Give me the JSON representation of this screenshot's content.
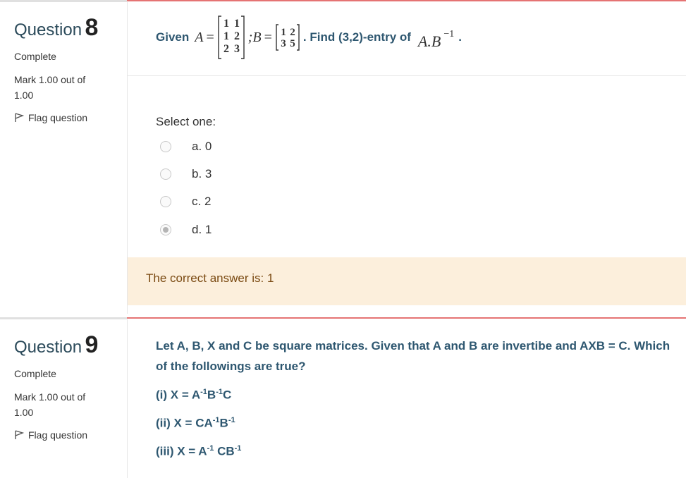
{
  "q8": {
    "label": "Question",
    "number": "8",
    "state": "Complete",
    "grade": "Mark 1.00 out of 1.00",
    "flag": "Flag question",
    "text_given": "Given",
    "math_A": "A",
    "math_eq": "=",
    "matrix_A": [
      [
        "1",
        "1"
      ],
      [
        "1",
        "2"
      ],
      [
        "2",
        "3"
      ]
    ],
    "math_sep": ";B",
    "matrix_B": [
      [
        "1",
        "2"
      ],
      [
        "3",
        "5"
      ]
    ],
    "text_find": ". Find (3,2)-entry of",
    "math_expr": "A.B",
    "math_exp": "−1",
    "math_end": ".",
    "prompt": "Select one:",
    "options": [
      {
        "label": "a. 0",
        "checked": false
      },
      {
        "label": "b. 3",
        "checked": false
      },
      {
        "label": "c. 2",
        "checked": false
      },
      {
        "label": "d. 1",
        "checked": true
      }
    ],
    "feedback": "The correct answer is: 1"
  },
  "q9": {
    "label": "Question",
    "number": "9",
    "state": "Complete",
    "grade": "Mark 1.00 out of 1.00",
    "flag": "Flag question",
    "text": "Let A, B, X and C be square matrices. Given that A and B are invertibe and AXB = C. Which of the followings are true?",
    "stmt1": {
      "a": "(i) X = A",
      "b": "-1",
      "c": "B",
      "d": "-1",
      "e": "C"
    },
    "stmt2": {
      "a": "(ii) X = CA",
      "b": "-1",
      "c": "B",
      "d": "-1"
    },
    "stmt3": {
      "a": "(iii) X = A",
      "b": "-1",
      "c": " CB",
      "d": "-1"
    }
  },
  "colors": {
    "accent_red": "#e57373",
    "question_text": "#2e5770",
    "feedback_bg": "#fcefdc"
  }
}
